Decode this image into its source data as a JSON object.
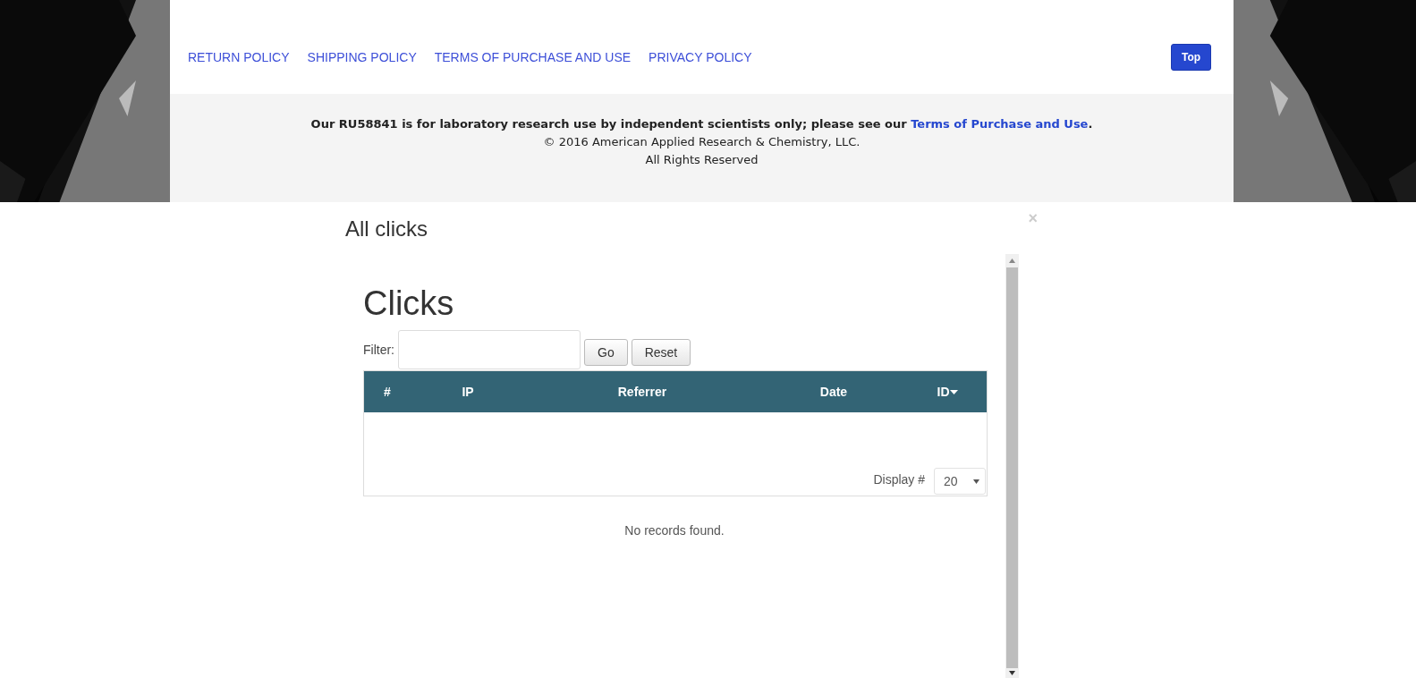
{
  "nav": {
    "links": [
      "RETURN POLICY",
      "SHIPPING POLICY",
      "TERMS OF PURCHASE AND USE",
      "PRIVACY POLICY"
    ],
    "top_button": "Top"
  },
  "footer": {
    "disclaimer": "Our RU58841 is for laboratory research use by independent scientists only; please see our",
    "disclaimer_link": "Terms of Purchase and Use",
    "disclaimer_end": ".",
    "copyright": "© 2016 American Applied Research & Chemistry, LLC.",
    "rights": "All Rights Reserved"
  },
  "modal": {
    "title": "All clicks",
    "close": "×",
    "heading": "Clicks",
    "filter_label": "Filter:",
    "buttons": [
      "Go",
      "Reset"
    ],
    "table": {
      "columns": [
        {
          "label": "#",
          "sorted": false
        },
        {
          "label": "IP",
          "sorted": false
        },
        {
          "label": "Referrer",
          "sorted": false
        },
        {
          "label": "Date",
          "sorted": false
        },
        {
          "label": "ID",
          "sorted": true
        }
      ],
      "display_label": "Display #",
      "display_value": "20"
    },
    "empty_message": "No records found."
  }
}
